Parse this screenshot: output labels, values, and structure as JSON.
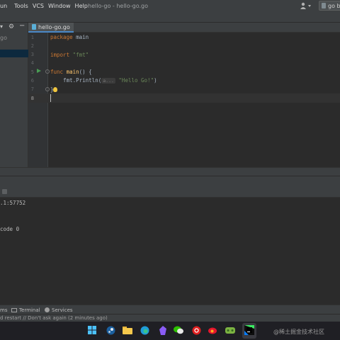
{
  "menubar": {
    "items": [
      "un",
      "Tools",
      "VCS",
      "Window",
      "Help"
    ],
    "window_title": "hello-go - hello-go.go"
  },
  "toolbar": {
    "run_config_label": "go b"
  },
  "project": {
    "item_label": "go"
  },
  "editor": {
    "tab_label": "hello-go.go",
    "line_numbers": [
      "1",
      "2",
      "3",
      "4",
      "5",
      "6",
      "7",
      "8"
    ],
    "lines": {
      "l1_kw": "package",
      "l1_rest": " main",
      "l3_kw": "import",
      "l3_str": "\"fmt\"",
      "l5_kw": "func",
      "l5_fn": "main",
      "l5_rest": "() {",
      "l6_pre": "    fmt.Println(",
      "l6_hint": "a...",
      "l6_str": "\"Hello Go!\"",
      "l6_post": ")",
      "l7": "}"
    }
  },
  "console": {
    "lines": [
      ".1:57752",
      "code 0"
    ]
  },
  "tool_tabs": {
    "problems": "ms",
    "terminal": "Terminal",
    "services": "Services"
  },
  "status": {
    "message": "d restart // Don't ask again (2 minutes ago)"
  },
  "watermark": "@稀土掘金技术社区",
  "colors": {
    "keyword": "#cc7832",
    "string": "#6a8759",
    "function": "#ffc66d",
    "selection": "#0d293e",
    "accent": "#4a88c7"
  }
}
